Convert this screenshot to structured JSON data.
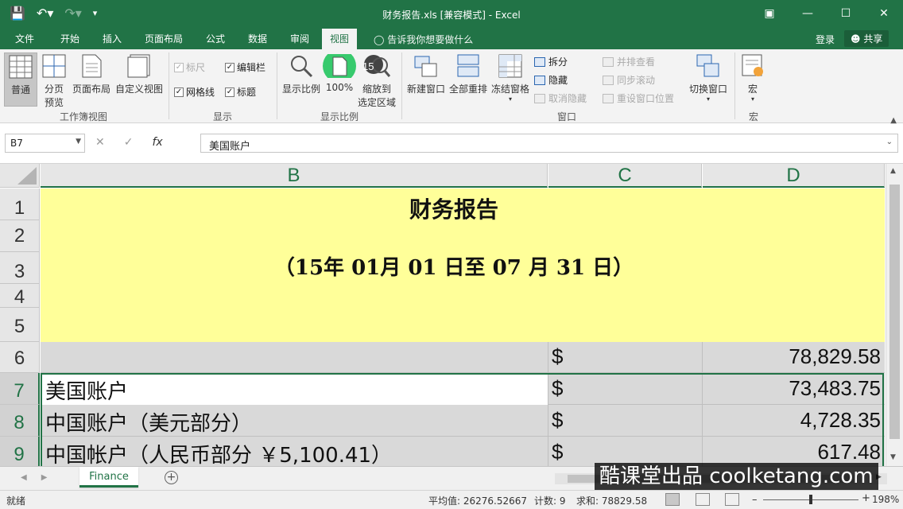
{
  "window": {
    "title": "财务报告.xls  [兼容模式] - Excel"
  },
  "tabs": {
    "items": [
      "文件",
      "开始",
      "插入",
      "页面布局",
      "公式",
      "数据",
      "审阅",
      "视图"
    ],
    "active": "视图",
    "tell_me": "告诉我你想要做什么",
    "login": "登录",
    "share": "共享"
  },
  "ribbon": {
    "workbook_views": {
      "normal": "普通",
      "page_break_1": "分页",
      "page_break_2": "预览",
      "page_layout": "页面布局",
      "custom_views": "自定义视图",
      "group_label": "工作簿视图"
    },
    "show": {
      "ruler": "标尺",
      "formula_bar": "编辑栏",
      "gridlines": "网格线",
      "headings": "标题",
      "group_label": "显示"
    },
    "zoom": {
      "zoom": "显示比例",
      "hundred": "100%",
      "zoom_sel_1": "缩放到",
      "zoom_sel_2": "选定区域",
      "group_label": "显示比例",
      "step_badge": "15"
    },
    "window": {
      "new_window": "新建窗口",
      "arrange_all": "全部重排",
      "freeze": "冻结窗格",
      "split": "拆分",
      "hide": "隐藏",
      "unhide": "取消隐藏",
      "side_by_side": "并排查看",
      "sync_scroll": "同步滚动",
      "reset_pos": "重设窗口位置",
      "switch": "切换窗口",
      "group_label": "窗口"
    },
    "macros": {
      "macro": "宏",
      "group_label": "宏"
    }
  },
  "formula_bar": {
    "name_box": "B7",
    "formula": "美国账户"
  },
  "grid": {
    "columns": [
      "B",
      "C",
      "D"
    ],
    "rows": [
      "1",
      "2",
      "3",
      "4",
      "5",
      "6",
      "7",
      "8",
      "9"
    ],
    "title": "财务报告",
    "subtitle": "（15年 01月 01 日至 07 月 31 日）",
    "row6": {
      "dollar": "$",
      "value": "78,829.58"
    },
    "row7": {
      "label": "美国账户",
      "dollar": "$",
      "value": "73,483.75"
    },
    "row8": {
      "label": "中国账户（美元部分）",
      "dollar": "$",
      "value": "4,728.35"
    },
    "row9": {
      "label": "中国帐户（人民币部分 ￥5,100.41）",
      "dollar": "$",
      "value": "617.48"
    }
  },
  "sheet": {
    "tab": "Finance"
  },
  "watermark": "酷课堂出品 coolketang.com",
  "status": {
    "ready": "就绪",
    "average": "平均值: 26276.52667",
    "count": "计数: 9",
    "sum": "求和: 78829.58",
    "zoom": "198%"
  },
  "colors": {
    "accent": "#217346",
    "title_fill": "#ffff99",
    "row_gray": "#d9d9d9"
  }
}
